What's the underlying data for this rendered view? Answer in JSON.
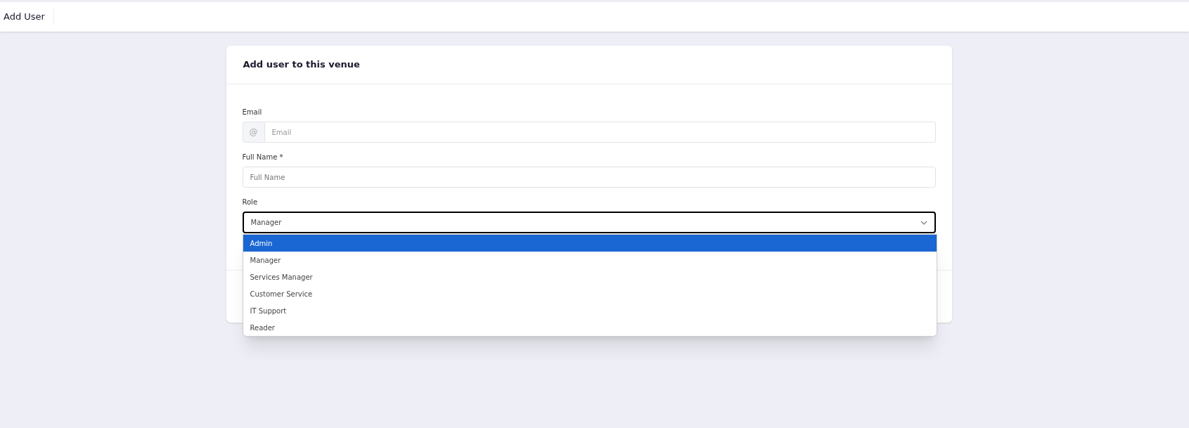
{
  "header": {
    "title": "Add User"
  },
  "card": {
    "title": "Add user to this venue",
    "email": {
      "label": "Email",
      "prefix": "@",
      "placeholder": "Email"
    },
    "full_name": {
      "label": "Full Name *",
      "placeholder": "Full Name"
    },
    "role": {
      "label": "Role",
      "value": "Manager",
      "expanded": true,
      "options": [
        {
          "label": "Admin",
          "highlighted": true
        },
        {
          "label": "Manager",
          "highlighted": false
        },
        {
          "label": "Services Manager",
          "highlighted": false
        },
        {
          "label": "Customer Service",
          "highlighted": false
        },
        {
          "label": "IT Support",
          "highlighted": false
        },
        {
          "label": "Reader",
          "highlighted": false
        }
      ]
    }
  }
}
